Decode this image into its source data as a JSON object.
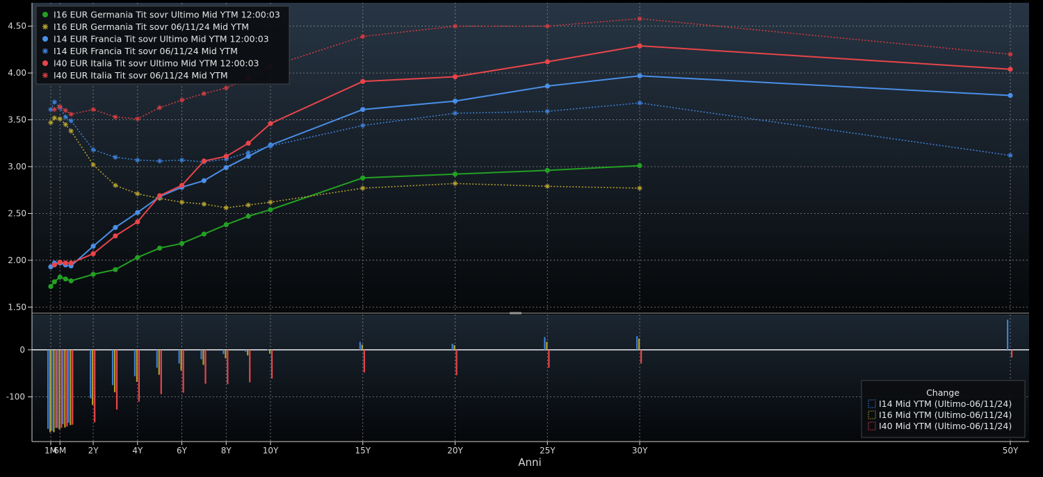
{
  "chart_data": {
    "type": "line",
    "xlabel": "Anni",
    "x_tick_labels": [
      "1M",
      "6M",
      "2Y",
      "4Y",
      "6Y",
      "8Y",
      "10Y",
      "15Y",
      "20Y",
      "25Y",
      "30Y",
      "50Y"
    ],
    "top_panel": {
      "ylim": [
        1.45,
        4.75
      ],
      "y_ticks": [
        "1.50",
        "2.00",
        "2.50",
        "3.00",
        "3.50",
        "4.00",
        "4.50"
      ],
      "grid": true,
      "legend_position": "top-left",
      "series": [
        {
          "name": "I16 EUR Germania Tit sovr Ultimo Mid YTM 12:00:03",
          "color": "#23a023",
          "style": "solid",
          "marker": "dot",
          "x": [
            "1M",
            "3M",
            "6M",
            "9M",
            "1Y",
            "2Y",
            "3Y",
            "4Y",
            "5Y",
            "6Y",
            "7Y",
            "8Y",
            "9Y",
            "10Y",
            "15Y",
            "20Y",
            "25Y",
            "30Y"
          ],
          "y": [
            1.72,
            1.77,
            1.82,
            1.8,
            1.78,
            1.85,
            1.9,
            2.03,
            2.13,
            2.18,
            2.28,
            2.38,
            2.47,
            2.54,
            2.88,
            2.92,
            2.96,
            3.01
          ]
        },
        {
          "name": "I16 EUR Germania Tit sovr 06/11/24 Mid YTM",
          "color": "#b5a12e",
          "style": "dotted",
          "marker": "star",
          "x": [
            "1M",
            "3M",
            "6M",
            "9M",
            "1Y",
            "2Y",
            "3Y",
            "4Y",
            "5Y",
            "6Y",
            "7Y",
            "8Y",
            "9Y",
            "10Y",
            "15Y",
            "20Y",
            "25Y",
            "30Y"
          ],
          "y": [
            3.47,
            3.52,
            3.51,
            3.45,
            3.38,
            3.02,
            2.8,
            2.71,
            2.66,
            2.62,
            2.6,
            2.56,
            2.59,
            2.62,
            2.77,
            2.82,
            2.79,
            2.77
          ]
        },
        {
          "name": "I14 EUR Francia Tit sovr Ultimo Mid YTM 12:00:03",
          "color": "#4a8fe8",
          "style": "solid",
          "marker": "dot",
          "x": [
            "1M",
            "3M",
            "6M",
            "9M",
            "1Y",
            "2Y",
            "3Y",
            "4Y",
            "5Y",
            "6Y",
            "7Y",
            "8Y",
            "9Y",
            "10Y",
            "15Y",
            "20Y",
            "25Y",
            "30Y",
            "50Y"
          ],
          "y": [
            1.93,
            1.97,
            1.97,
            1.95,
            1.94,
            2.15,
            2.35,
            2.51,
            2.68,
            2.78,
            2.85,
            2.99,
            3.11,
            3.23,
            3.61,
            3.7,
            3.86,
            3.97,
            3.76
          ]
        },
        {
          "name": "I14 EUR Francia Tit sovr 06/11/24 Mid YTM",
          "color": "#3d7fd6",
          "style": "dotted",
          "marker": "star",
          "x": [
            "1M",
            "3M",
            "6M",
            "9M",
            "1Y",
            "2Y",
            "3Y",
            "4Y",
            "5Y",
            "6Y",
            "7Y",
            "8Y",
            "9Y",
            "10Y",
            "15Y",
            "20Y",
            "25Y",
            "30Y",
            "50Y"
          ],
          "y": [
            3.61,
            3.69,
            3.63,
            3.53,
            3.49,
            3.18,
            3.1,
            3.07,
            3.06,
            3.07,
            3.05,
            3.08,
            3.15,
            3.22,
            3.44,
            3.57,
            3.59,
            3.68,
            3.12
          ]
        },
        {
          "name": "I40 EUR Italia Tit sovr Ultimo Mid YTM 12:00:03",
          "color": "#e8454a",
          "style": "solid",
          "marker": "dot",
          "x": [
            "3M",
            "6M",
            "9M",
            "1Y",
            "2Y",
            "3Y",
            "4Y",
            "5Y",
            "6Y",
            "7Y",
            "8Y",
            "9Y",
            "10Y",
            "15Y",
            "20Y",
            "25Y",
            "30Y",
            "50Y"
          ],
          "y": [
            1.95,
            1.98,
            1.97,
            1.97,
            2.07,
            2.26,
            2.41,
            2.69,
            2.8,
            3.06,
            3.11,
            3.25,
            3.46,
            3.91,
            3.96,
            4.12,
            4.29,
            4.04
          ]
        },
        {
          "name": "I40 EUR Italia Tit sovr 06/11/24 Mid YTM",
          "color": "#d23c41",
          "style": "dotted",
          "marker": "star",
          "x": [
            "3M",
            "6M",
            "9M",
            "1Y",
            "2Y",
            "3Y",
            "4Y",
            "5Y",
            "6Y",
            "7Y",
            "8Y",
            "9Y",
            "10Y",
            "15Y",
            "20Y",
            "25Y",
            "30Y",
            "50Y"
          ],
          "y": [
            3.61,
            3.64,
            3.6,
            3.56,
            3.61,
            3.53,
            3.51,
            3.63,
            3.71,
            3.78,
            3.84,
            3.94,
            4.07,
            4.39,
            4.5,
            4.5,
            4.58,
            4.2
          ]
        }
      ]
    },
    "bottom_panel": {
      "title": "Change",
      "ylim": [
        -195,
        75
      ],
      "y_ticks": [
        "0",
        "-100"
      ],
      "grid": true,
      "legend_position": "bottom-right",
      "series": [
        {
          "name": "I14 Mid YTM (Ultimo-06/11/24)",
          "color": "#3d7fd6",
          "x": [
            "1M",
            "3M",
            "6M",
            "9M",
            "1Y",
            "2Y",
            "3Y",
            "4Y",
            "5Y",
            "6Y",
            "7Y",
            "8Y",
            "9Y",
            "10Y",
            "15Y",
            "20Y",
            "25Y",
            "30Y",
            "50Y"
          ],
          "values": [
            -168,
            -172,
            -166,
            -158,
            -155,
            -103,
            -75,
            -56,
            -38,
            -29,
            -20,
            -9,
            -4,
            1,
            17,
            13,
            27,
            29,
            64
          ]
        },
        {
          "name": "I16 Mid YTM (Ultimo-06/11/24)",
          "color": "#b5a12e",
          "x": [
            "1M",
            "3M",
            "6M",
            "9M",
            "1Y",
            "2Y",
            "3Y",
            "4Y",
            "5Y",
            "6Y",
            "7Y",
            "8Y",
            "9Y",
            "10Y",
            "15Y",
            "20Y",
            "25Y",
            "30Y"
          ],
          "values": [
            -175,
            -175,
            -169,
            -165,
            -160,
            -117,
            -90,
            -68,
            -53,
            -44,
            -32,
            -18,
            -12,
            -8,
            11,
            10,
            17,
            24
          ]
        },
        {
          "name": "I40 Mid YTM (Ultimo-06/11/24)",
          "color": "#e8454a",
          "x": [
            "3M",
            "6M",
            "9M",
            "1Y",
            "2Y",
            "3Y",
            "4Y",
            "5Y",
            "6Y",
            "7Y",
            "8Y",
            "9Y",
            "10Y",
            "15Y",
            "20Y",
            "25Y",
            "30Y",
            "50Y"
          ],
          "values": [
            -166,
            -166,
            -163,
            -159,
            -154,
            -127,
            -110,
            -94,
            -91,
            -72,
            -73,
            -69,
            -61,
            -48,
            -54,
            -38,
            -29,
            -16
          ]
        }
      ]
    }
  }
}
